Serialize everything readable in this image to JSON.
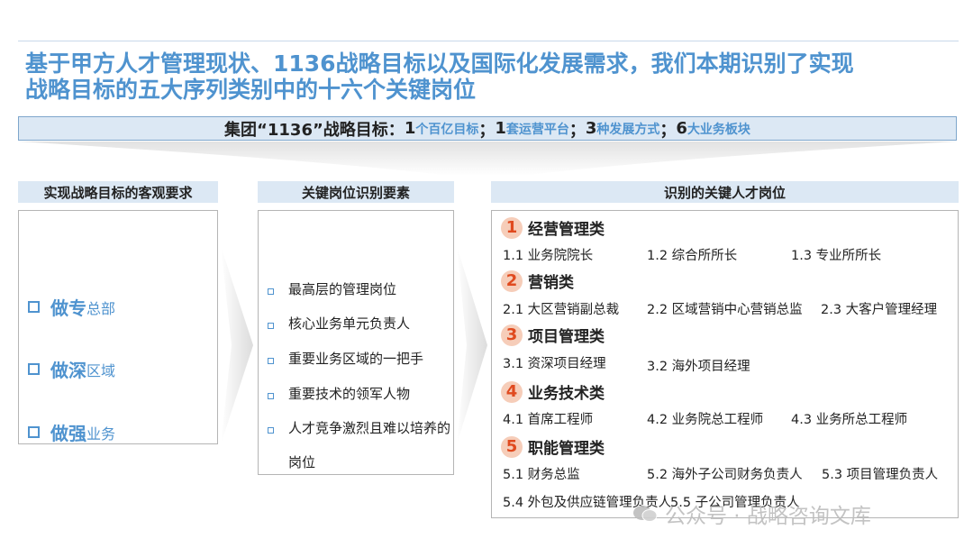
{
  "header": {
    "title_line1": "基于甲方人才管理现状、1136战略目标以及国际化发展需求，我们本期识别了实现",
    "title_line2": "战略目标的五大序列类别中的十六个关键岗位"
  },
  "goal": {
    "prefix": "集团“1136”战略目标：",
    "n1": "1",
    "t1": "个百亿目标",
    "s1": "；",
    "n2": "1",
    "t2": "套运营平台",
    "s2": "；",
    "n3": "3",
    "t3": "种发展方式",
    "s3": "；",
    "n4": "6",
    "t4": "大业务板块"
  },
  "col1": {
    "heading": "实现战略目标的客观要求",
    "items": [
      {
        "big": "做专",
        "small": "总部"
      },
      {
        "big": "做深",
        "small": "区域"
      },
      {
        "big": "做强",
        "small": "业务"
      }
    ]
  },
  "col2": {
    "heading": "关键岗位识别要素",
    "items": [
      "最高层的管理岗位",
      "核心业务单元负责人",
      "重要业务区域的一把手",
      "重要技术的领军人物",
      "人才竞争激烈且难以培养的岗位"
    ]
  },
  "col3": {
    "heading": "识别的关键人才岗位",
    "categories": [
      {
        "num": "1",
        "name": "经营管理类"
      },
      {
        "num": "2",
        "name": "营销类"
      },
      {
        "num": "3",
        "name": "项目管理类"
      },
      {
        "num": "4",
        "name": "业务技术类"
      },
      {
        "num": "5",
        "name": "职能管理类"
      }
    ],
    "positions": {
      "p11": "1.1 业务院院长",
      "p12": "1.2 综合所所长",
      "p13": "1.3 专业所所长",
      "p21": "2.1 大区营销副总裁",
      "p22": "2.2 区域营销中心营销总监",
      "p23": "2.3 大客户管理经理",
      "p31": "3.1 资深项目经理",
      "p32": "3.2 海外项目经理",
      "p41": "4.1 首席工程师",
      "p42": "4.2 业务院总工程师",
      "p43": "4.3 业务所总工程师",
      "p51": "5.1 财务总监",
      "p52": "5.2 海外子公司财务负责人",
      "p53": "5.3 项目管理负责人",
      "p54": "5.4 外包及供应链管理负责人",
      "p55": "5.5 子公司管理负责人"
    }
  },
  "watermark": "公众号 · 战略咨询文库",
  "colors": {
    "accent": "#4f93cf",
    "headbg": "#dce8f4",
    "circle": "#f6cdb9",
    "circle_text": "#e04a1f"
  }
}
